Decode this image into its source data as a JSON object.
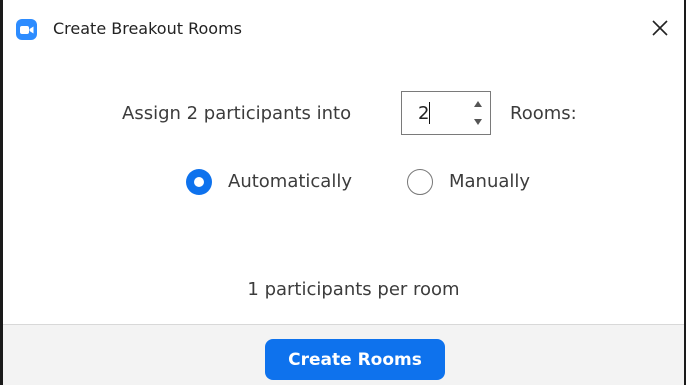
{
  "window": {
    "title": "Create Breakout Rooms",
    "app_icon": "zoom-camera-icon",
    "close_icon": "close-icon"
  },
  "assign": {
    "label": "Assign 2 participants into",
    "rooms_count": "2",
    "rooms_label": "Rooms:"
  },
  "mode": {
    "options": [
      {
        "label": "Automatically",
        "checked": true
      },
      {
        "label": "Manually",
        "checked": false
      }
    ]
  },
  "summary": {
    "per_room": "1 participants per room"
  },
  "footer": {
    "create_label": "Create Rooms"
  },
  "colors": {
    "accent": "#0e72ed",
    "app_icon_bg": "#2d8cff",
    "footer_bg": "#f3f3f3"
  }
}
